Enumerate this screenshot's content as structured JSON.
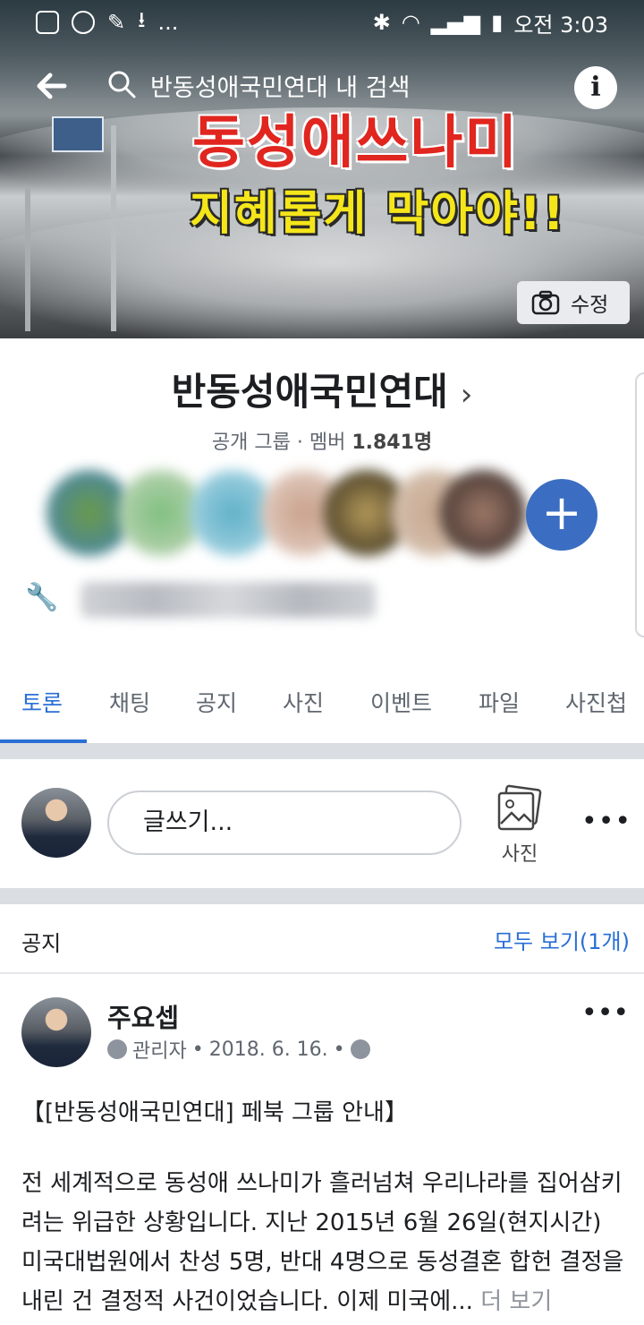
{
  "status_bar": {
    "time": "오전 3:03",
    "ellipsis": "..."
  },
  "cover": {
    "headline_top": "동성애쓰나미",
    "headline_bottom": "지혜롭게 막아야!!",
    "edit_label": "수정"
  },
  "search": {
    "placeholder": "반동성애국민연대 내 검색"
  },
  "group": {
    "name": "반동성애국민연대",
    "type": "공개 그룹",
    "members_label": "멤버",
    "members_count": "1.841명"
  },
  "tabs": [
    {
      "label": "토론",
      "active": true
    },
    {
      "label": "채팅"
    },
    {
      "label": "공지"
    },
    {
      "label": "사진"
    },
    {
      "label": "이벤트"
    },
    {
      "label": "파일"
    },
    {
      "label": "사진첩"
    }
  ],
  "composer": {
    "placeholder": "글쓰기...",
    "photo_label": "사진"
  },
  "notice": {
    "label": "공지",
    "see_all": "모두 보기(1개)"
  },
  "post": {
    "author": "주요셉",
    "role": "관리자",
    "date": "2018. 6. 16.",
    "title": "【[반동성애국민연대] 페북 그룹 안내】",
    "body": "전 세계적으로 동성애 쓰나미가 흘러넘쳐 우리나라를 집어삼키려는 위급한 상황입니다. 지난 2015년 6월 26일(현지시간) 미국대법원에서 찬성 5명, 반대 4명으로 동성결혼 합헌 결정을 내린 건 결정적 사건이었습니다. 이제 미국에...",
    "more_label": "더 보기"
  },
  "colors": {
    "accent": "#2a6fd6",
    "add_button": "#3b6ec2"
  }
}
